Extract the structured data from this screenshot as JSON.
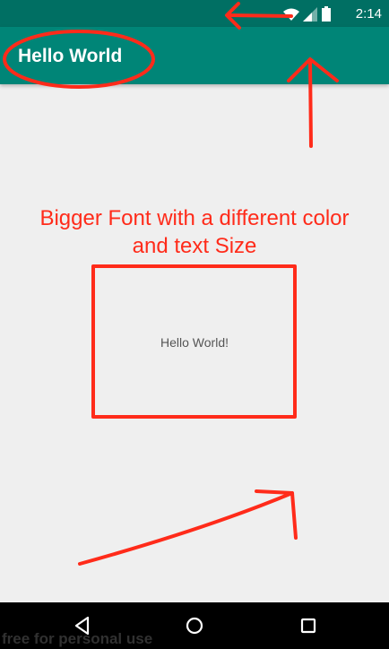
{
  "status_bar": {
    "time": "2:14"
  },
  "app_bar": {
    "title": "Hello World"
  },
  "main": {
    "hello_text": "Hello World!"
  },
  "annotation": {
    "line1": "Bigger Font with a different color",
    "line2": "and text Size",
    "color": "#ff2b1a"
  },
  "navigation": {
    "back_icon": "back-triangle-icon",
    "home_icon": "home-circle-icon",
    "recents_icon": "recents-square-icon"
  },
  "watermark": {
    "text": "free for personal use"
  },
  "colors": {
    "status_bar": "#006f63",
    "app_bar": "#008577",
    "background": "#efefef",
    "nav_bar": "#000000"
  }
}
